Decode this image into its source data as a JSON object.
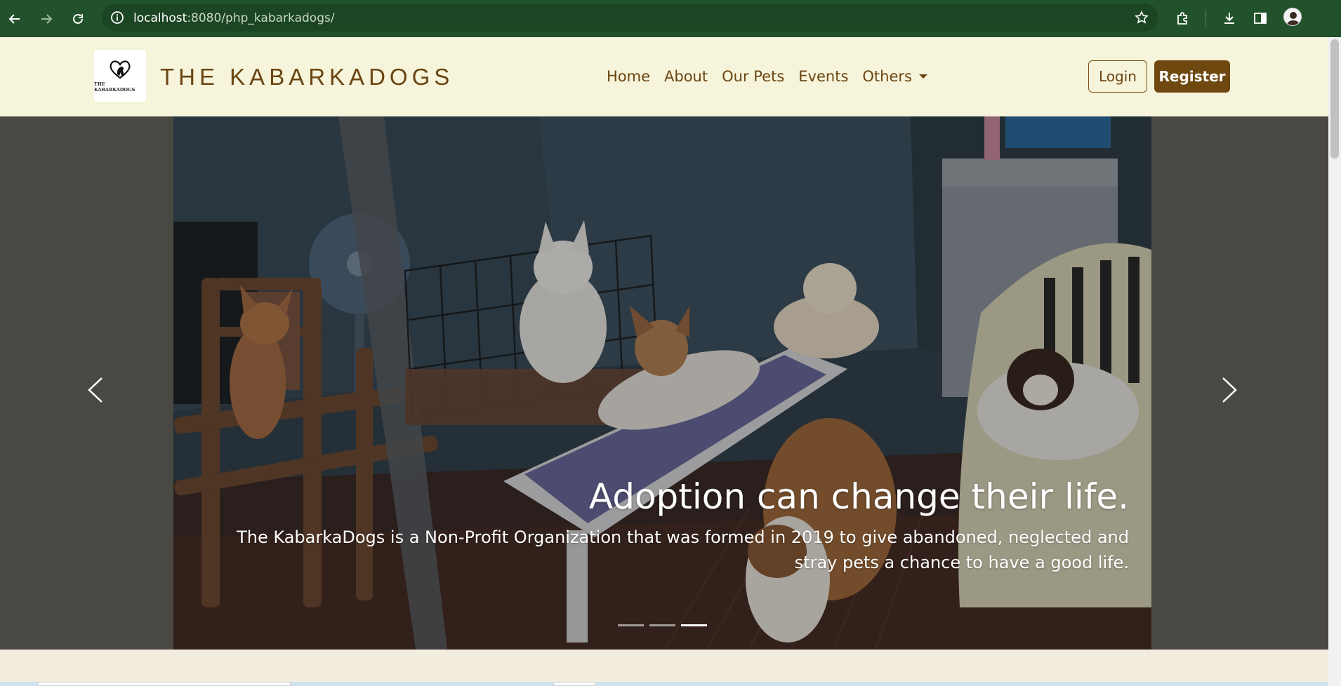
{
  "browser": {
    "url_host": "localhost",
    "url_rest": ":8080/php_kabarkadogs/",
    "theme_color": "#22522b"
  },
  "site": {
    "logo_caption": "THE KABARKADOGS",
    "brand_name": "THE KABARKADOGS",
    "brand_color": "#6a4513",
    "navbar_bg": "#f6f4da",
    "menu": [
      {
        "label": "Home"
      },
      {
        "label": "About"
      },
      {
        "label": "Our Pets"
      },
      {
        "label": "Events"
      },
      {
        "label": "Others"
      }
    ],
    "login_label": "Login",
    "register_label": "Register"
  },
  "carousel": {
    "title": "Adoption can change their life.",
    "text": "The KabarkaDogs is a Non-Profit Organization that was formed in 2019 to give abandoned, neglected and stray pets a chance to have a good life.",
    "slide_count": 3,
    "active_index": 3
  },
  "icons": {
    "back": "arrow-left-icon",
    "forward": "arrow-right-icon",
    "reload": "reload-icon",
    "info": "info-icon",
    "star": "star-icon",
    "extensions": "puzzle-icon",
    "download": "download-icon",
    "sidepanel": "sidepanel-icon",
    "prev": "chevron-left-icon",
    "next": "chevron-right-icon"
  }
}
